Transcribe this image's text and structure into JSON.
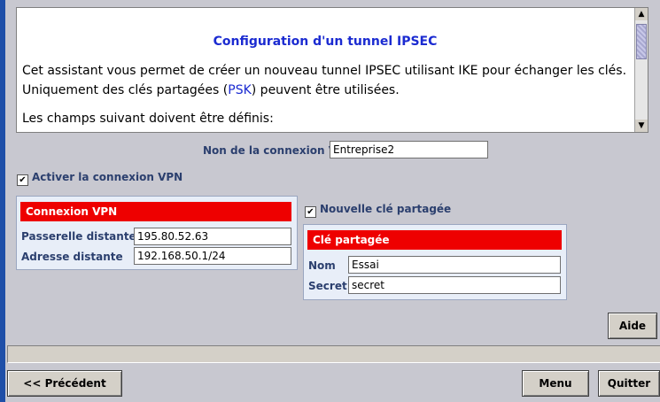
{
  "intro": {
    "title": "Configuration d'un tunnel IPSEC",
    "para1": "Cet assistant vous permet de créer un nouveau tunnel IPSEC utilisant IKE pour échanger les clés.",
    "para2_a": "Uniquement des clés partagées (",
    "para2_link": "PSK",
    "para2_b": ") peuvent être utilisées.",
    "para3": "Les champs suivant doivent être définis:"
  },
  "connection_name": {
    "label": "Non de la connexion VPN",
    "value": "Entreprise2"
  },
  "activate": {
    "label": "Activer la connexion VPN",
    "checked": true
  },
  "vpn_panel": {
    "title": "Connexion VPN",
    "remote_gateway_label": "Passerelle distante",
    "remote_gateway_value": "195.80.52.63",
    "remote_address_label": "Adresse distante",
    "remote_address_value": "192.168.50.1/24"
  },
  "new_key": {
    "label": "Nouvelle clé partagée",
    "checked": true
  },
  "key_panel": {
    "title": "Clé partagée",
    "name_label": "Nom",
    "name_value": "Essai",
    "secret_label": "Secret",
    "secret_value": "secret"
  },
  "buttons": {
    "help": "Aide",
    "previous": "<< Précédent",
    "menu": "Menu",
    "quit": "Quitter"
  },
  "colors": {
    "accent_red": "#ee0000",
    "link_blue": "#1b2bd1",
    "label_navy": "#2b3f6e"
  }
}
